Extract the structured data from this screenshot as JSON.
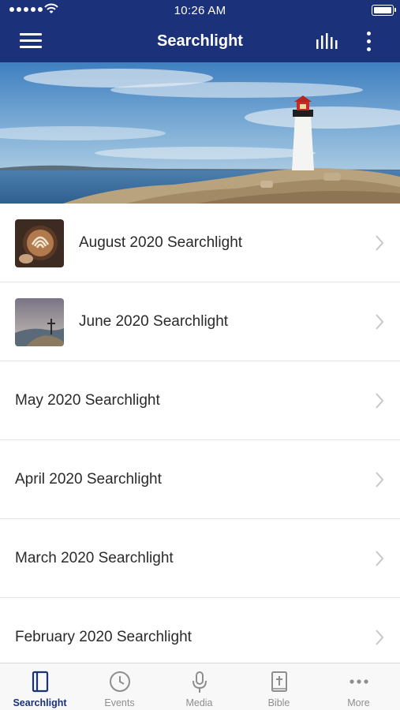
{
  "status_bar": {
    "time": "10:26 AM"
  },
  "nav": {
    "title": "Searchlight"
  },
  "colors": {
    "accent": "#1b3179",
    "inactive": "#8e8e8e",
    "divider": "#e4e4e4"
  },
  "list": {
    "items": [
      {
        "label": "August 2020 Searchlight",
        "thumbnail": "latte-art-image"
      },
      {
        "label": "June 2020 Searchlight",
        "thumbnail": "mountain-cross-image"
      },
      {
        "label": "May 2020 Searchlight"
      },
      {
        "label": "April 2020 Searchlight"
      },
      {
        "label": "March 2020 Searchlight"
      },
      {
        "label": "February 2020 Searchlight"
      }
    ]
  },
  "tabbar": {
    "tabs": [
      {
        "label": "Searchlight",
        "icon": "book-panel-icon",
        "active": true
      },
      {
        "label": "Events",
        "icon": "clock-icon"
      },
      {
        "label": "Media",
        "icon": "microphone-icon"
      },
      {
        "label": "Bible",
        "icon": "bible-cross-icon"
      },
      {
        "label": "More",
        "icon": "ellipsis-icon"
      }
    ]
  }
}
